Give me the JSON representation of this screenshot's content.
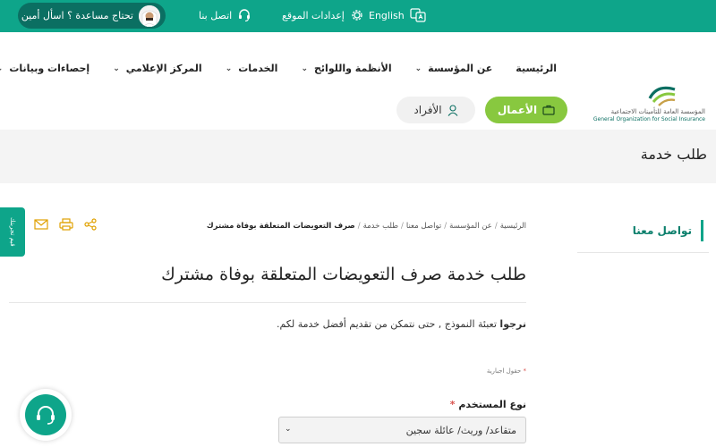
{
  "topbar": {
    "assistant_label": "تحتاج مساعدة ؟ اسأل أمين",
    "contact_label": "اتصل بنا",
    "settings_label": "إعدادات الموقع",
    "language_label": "English"
  },
  "nav": {
    "items": [
      {
        "label": "الرئيسية"
      },
      {
        "label": "عن المؤسسة"
      },
      {
        "label": "الأنظمة واللوائح"
      },
      {
        "label": "الخدمات"
      },
      {
        "label": "المركز الإعلامي"
      },
      {
        "label": "إحصاءات وبيانات"
      }
    ]
  },
  "logo": {
    "name_ar": "المؤسسة العامة للتأمينات الاجتماعية",
    "name_en": "General Organization for Social Insurance"
  },
  "audience": {
    "business_label": "الأعمال",
    "individuals_label": "الأفراد"
  },
  "page_band": {
    "title": "طلب خدمة"
  },
  "side_tab": {
    "label": "قيم تجربتك"
  },
  "sidebar": {
    "title": "تواصل معنا"
  },
  "breadcrumb": {
    "items": [
      "الرئيسية",
      "عن المؤسسة",
      "تواصل معنا",
      "طلب خدمة"
    ],
    "current": "صرف التعويضات المتعلقة بوفاة مشترك"
  },
  "main": {
    "title": "طلب خدمة  صرف التعويضات المتعلقة بوفاة مشترك",
    "intro_bold": "نرجوا",
    "intro_rest": "تعبئة النموذج , حتى نتمكن من تقديم أفضل خدمة لكم.",
    "required_note": "حقول اجبارية",
    "user_type_label": "نوع المستخدم",
    "user_type_value": "متقاعد/ وريث/ عائلة سجين"
  },
  "colors": {
    "primary": "#0ea58a",
    "primary_dark": "#0b6f62",
    "business_green": "#88c83f",
    "band_gray": "#f4f4f4"
  }
}
